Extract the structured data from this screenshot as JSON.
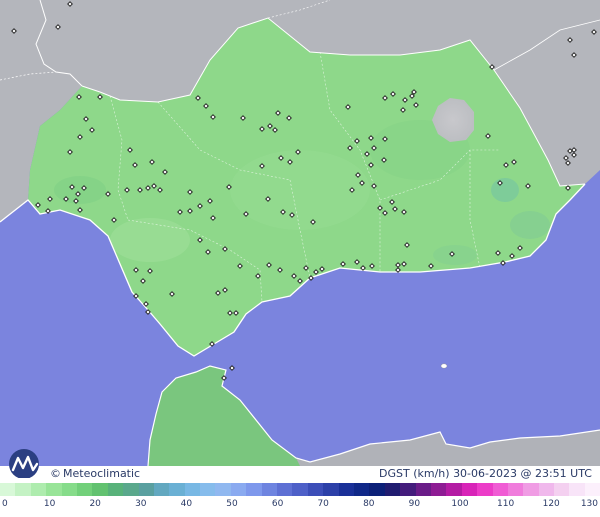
{
  "credit": {
    "symbol": "©",
    "name": "Meteoclimatic"
  },
  "product": {
    "variable": "DGST",
    "unit": "(km/h)",
    "datetime": "30-06-2023 @ 23:51 UTC"
  },
  "scale": {
    "labels": [
      "0",
      "10",
      "20",
      "30",
      "40",
      "50",
      "60",
      "70",
      "80",
      "90",
      "100",
      "110",
      "120",
      "130"
    ],
    "colors": [
      "#d8f8d8",
      "#c4f2c4",
      "#aeecae",
      "#98e498",
      "#86dc8a",
      "#72d07a",
      "#62c270",
      "#58b27a",
      "#5aa88c",
      "#5aa0a0",
      "#62a8c0",
      "#6ab0d4",
      "#78b8e4",
      "#86bcec",
      "#90b8f0",
      "#8aaaf0",
      "#7e98ec",
      "#6e84e0",
      "#5e70d4",
      "#4e60c8",
      "#3c4eb8",
      "#2c40a8",
      "#1a3098",
      "#102888",
      "#0c2078",
      "#201c70",
      "#441c7c",
      "#6a1c88",
      "#8e1c94",
      "#b41ca4",
      "#d824b8",
      "#ec3cc8",
      "#f05cd4",
      "#f07cdc",
      "#f09ce4",
      "#f0b8ec",
      "#f4d0f0",
      "#f8e4f8",
      "#fcf0fc"
    ],
    "colors_meaning": "wind gust colour ramp from 0 to 130 km/h"
  },
  "map": {
    "colors": {
      "sea": "#7b84de",
      "land_outside": "#b4b6bc",
      "gust_low": "#8ed88a",
      "station": "#1a1a1a"
    }
  }
}
